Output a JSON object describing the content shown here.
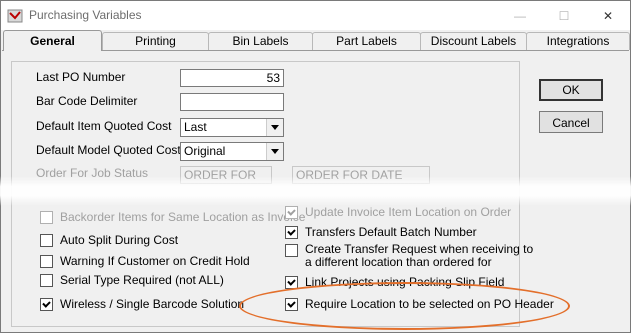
{
  "window": {
    "title": "Purchasing Variables",
    "minimize": "—",
    "maximize": "☐",
    "close": "✕"
  },
  "tabs": [
    {
      "label": "General",
      "active": true
    },
    {
      "label": "Printing"
    },
    {
      "label": "Bin Labels"
    },
    {
      "label": "Part Labels"
    },
    {
      "label": "Discount Labels"
    },
    {
      "label": "Integrations"
    }
  ],
  "fields": {
    "last_po_number": {
      "label": "Last PO Number",
      "value": "53"
    },
    "bar_code_delimiter": {
      "label": "Bar Code Delimiter",
      "value": ""
    },
    "item_quoted_cost": {
      "label": "Default Item Quoted Cost",
      "value": "Last"
    },
    "model_quoted_cost": {
      "label": "Default Model Quoted Cost",
      "value": "Original"
    },
    "order_for_job_status": {
      "label": "Order For Job Status",
      "value1": "ORDER FOR",
      "value2": "ORDER FOR DATE"
    }
  },
  "buttons": {
    "ok": "OK",
    "cancel": "Cancel"
  },
  "checkboxes_left": [
    {
      "label": "Backorder Items for Same Location as Invoice",
      "checked": false,
      "disabled": true
    },
    {
      "label": "Auto Split  During Cost",
      "checked": false
    },
    {
      "label": "Warning If Customer on Credit Hold",
      "checked": false
    },
    {
      "label": "Serial Type Required (not ALL)",
      "checked": false
    },
    {
      "label": "Wireless / Single Barcode Solution",
      "checked": true
    }
  ],
  "checkboxes_right": [
    {
      "label": "Update Invoice Item Location on Order",
      "checked": true,
      "disabled": true
    },
    {
      "label": "Transfers Default Batch Number",
      "checked": true
    },
    {
      "label": "Create Transfer Request when receiving to",
      "label2": "a different location than ordered for",
      "checked": false
    },
    {
      "label": "Link Projects using Packing Slip Field",
      "checked": true
    },
    {
      "label": "Require Location to be selected on PO Header",
      "checked": true
    }
  ],
  "colors": {
    "highlight": "#e36f2b"
  },
  "icons": {
    "app": "purchasing-app-icon",
    "combo": "chevron-down-icon"
  }
}
